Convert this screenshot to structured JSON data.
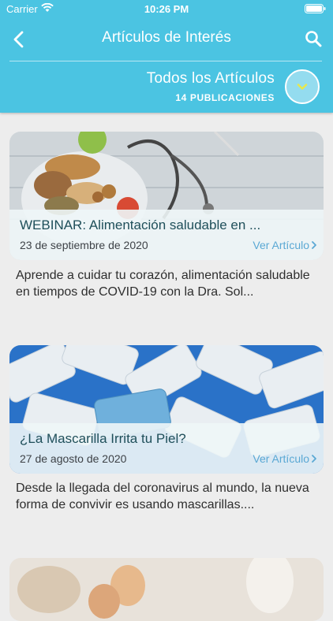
{
  "status_bar": {
    "carrier": "Carrier",
    "time": "10:26 PM"
  },
  "nav": {
    "title": "Artículos de Interés",
    "back_icon": "chevron-left-icon",
    "search_icon": "search-icon"
  },
  "filter": {
    "title": "Todos los Artículos",
    "count": "14 PUBLICACIONES",
    "dropdown_icon": "chevron-down-icon"
  },
  "colors": {
    "header": "#4bc4e2",
    "link": "#5aa8d4",
    "background": "#ededed",
    "dropdown_fill": "#94dcef",
    "dropdown_chevron": "#e9e84a"
  },
  "articles": [
    {
      "title": "WEBINAR: Alimentación saludable en ...",
      "date": "23 de septiembre de 2020",
      "link_label": "Ver Artículo",
      "excerpt": "Aprende a cuidar tu corazón, alimentación saludable en tiempos de COVID-19 con la Dra. Sol..."
    },
    {
      "title": "¿La Mascarilla Irrita tu Piel?",
      "date": "27 de agosto de 2020",
      "link_label": "Ver Artículo",
      "excerpt": "Desde la llegada del coronavirus al mundo, la nueva forma de convivir es usando mascarillas...."
    }
  ]
}
